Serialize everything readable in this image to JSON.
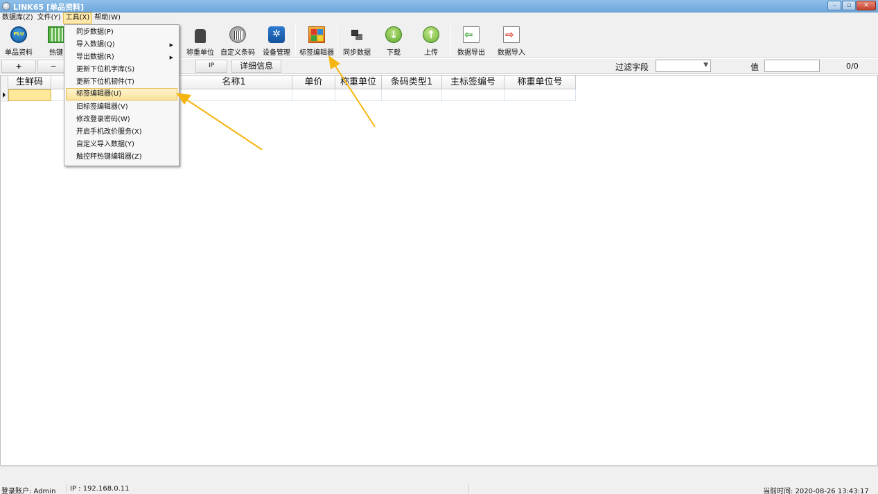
{
  "window": {
    "title": "LINK65 [单品资料]",
    "controls": {
      "minimize": "–",
      "maximize": "▫",
      "close": "✕"
    }
  },
  "menubar": {
    "items": [
      "数据库(Z)",
      "文件(Y)",
      "工具(X)",
      "帮助(W)"
    ],
    "active": "工具(X)"
  },
  "toolbar": {
    "items": [
      {
        "label": "单品资料",
        "icon": "plu-icon",
        "icon_text": "PLU"
      },
      {
        "label": "热键",
        "icon": "hotkey-icon"
      },
      {
        "label": "称重单位",
        "icon": "weight-icon"
      },
      {
        "label": "自定义条码",
        "icon": "barcode-icon"
      },
      {
        "label": "设备管理",
        "icon": "device-settings-icon"
      },
      {
        "label": "标签编辑器",
        "icon": "label-editor-icon"
      },
      {
        "label": "同步数据",
        "icon": "sync-icon"
      },
      {
        "label": "下载",
        "icon": "download-icon"
      },
      {
        "label": "上传",
        "icon": "upload-icon"
      },
      {
        "label": "数据导出",
        "icon": "export-icon"
      },
      {
        "label": "数据导入",
        "icon": "import-icon"
      }
    ]
  },
  "tools_menu": {
    "items": [
      {
        "label": "同步数据(P)",
        "submenu": false
      },
      {
        "label": "导入数据(Q)",
        "submenu": true
      },
      {
        "label": "导出数据(R)",
        "submenu": true
      },
      {
        "label": "更新下位机字库(S)",
        "submenu": false
      },
      {
        "label": "更新下位机韧件(T)",
        "submenu": false
      },
      {
        "label": "标签编辑器(U)",
        "submenu": false,
        "highlighted": true
      },
      {
        "label": "旧标签编辑器(V)",
        "submenu": false
      },
      {
        "label": "修改登录密码(W)",
        "submenu": false
      },
      {
        "label": "开启手机改价服务(X)",
        "submenu": false
      },
      {
        "label": "自定义导入数据(Y)",
        "submenu": false
      },
      {
        "label": "触控秤热键编辑器(Z)",
        "submenu": false
      }
    ]
  },
  "subbar": {
    "add": "+",
    "remove": "−",
    "ip": "IP",
    "details": "详细信息",
    "filter_label": "过滤字段",
    "filter_value": "",
    "value_label": "值",
    "value_input": "",
    "counter": "0/0"
  },
  "grid": {
    "columns": [
      "生鲜码",
      "",
      "名称1",
      "单价",
      "称重单位",
      "条码类型1",
      "主标签编号",
      "称重单位号"
    ],
    "rows": [
      [
        "",
        "",
        "",
        "",
        "",
        "",
        "",
        ""
      ]
    ]
  },
  "statusbar": {
    "account": "登录账户: Admin",
    "ip": "IP : 192.168.0.11",
    "time": "当前时间:  2020-08-26 13:43:17"
  },
  "colors": {
    "annotation_arrow": "#f5b50f",
    "menu_highlight": "#fbe29a",
    "titlebar": "#7fb4e2"
  }
}
